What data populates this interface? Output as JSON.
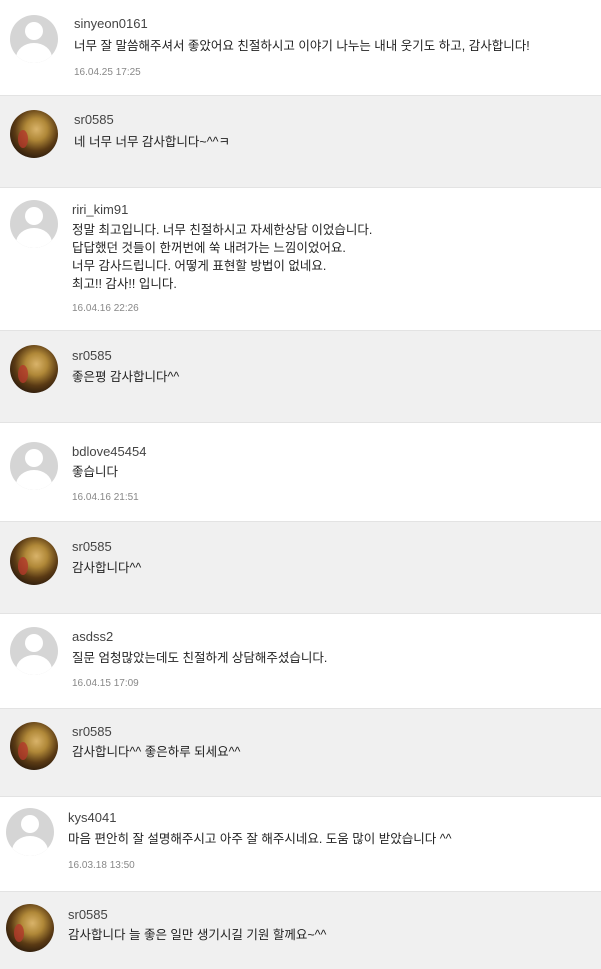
{
  "comments": [
    {
      "username": "sinyeon0161",
      "text": [
        "너무 잘 말씀해주셔서 좋았어요 친절하시고 이야기 나누는 내내 웃기도 하고, 감사합니다!"
      ],
      "date": "16.04.25 17:25",
      "avatar": "default-avatar-icon"
    },
    {
      "username": "sr0585",
      "text": [
        "네 너무 너무 감사합니다~^^ㅋ"
      ],
      "date": "",
      "avatar": "profile-photo"
    },
    {
      "username": "riri_kim91",
      "text": [
        "정말 최고입니다. 너무 친절하시고 자세한상담 이었습니다.",
        "답답했던 것들이 한꺼번에 쑥 내려가는 느낌이었어요.",
        "너무 감사드립니다. 어떻게 표현할 방법이 없네요.",
        "최고!! 감사!! 입니다."
      ],
      "date": "16.04.16 22:26",
      "avatar": "default-avatar-icon"
    },
    {
      "username": "sr0585",
      "text": [
        "좋은평 감사합니다^^"
      ],
      "date": "",
      "avatar": "profile-photo"
    },
    {
      "username": "bdlove45454",
      "text": [
        "좋습니다"
      ],
      "date": "16.04.16 21:51",
      "avatar": "default-avatar-icon"
    },
    {
      "username": "sr0585",
      "text": [
        "감사합니다^^"
      ],
      "date": "",
      "avatar": "profile-photo"
    },
    {
      "username": "asdss2",
      "text": [
        "질문 엄청많았는데도 친절하게 상담해주셨습니다."
      ],
      "date": "16.04.15 17:09",
      "avatar": "default-avatar-icon"
    },
    {
      "username": "sr0585",
      "text": [
        "감사합니다^^ 좋은하루 되세요^^"
      ],
      "date": "",
      "avatar": "profile-photo"
    },
    {
      "username": "kys4041",
      "text": [
        "마음 편안히 잘 설명해주시고 아주 잘 해주시네요. 도움 많이 받았습니다 ^^"
      ],
      "date": "16.03.18 13:50",
      "avatar": "default-avatar-icon"
    },
    {
      "username": "sr0585",
      "text": [
        "감사합니다 늘 좋은 일만 생기시길 기원 할께요~^^"
      ],
      "date": "",
      "avatar": "profile-photo"
    }
  ]
}
